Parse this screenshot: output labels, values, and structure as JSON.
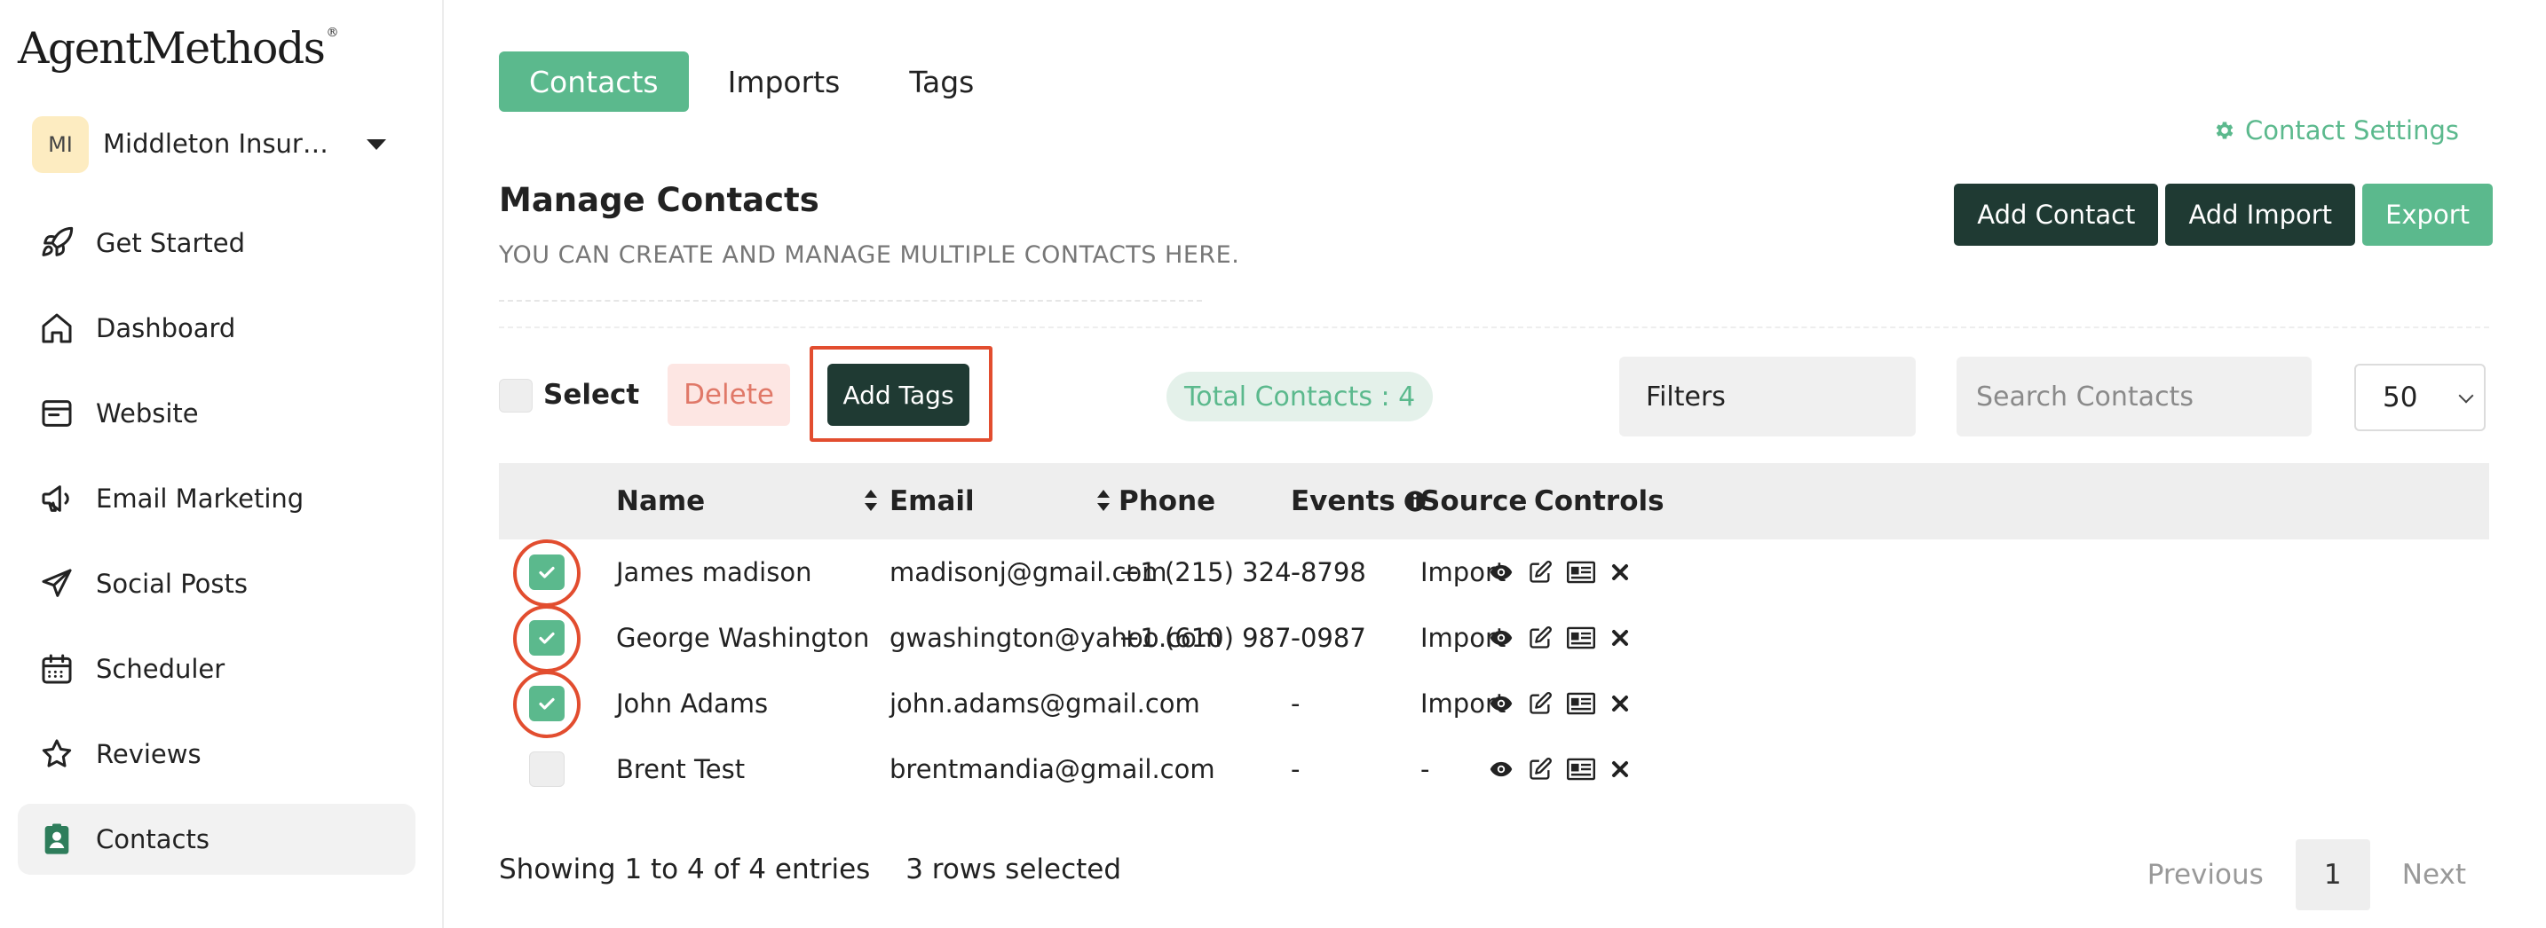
{
  "brand": {
    "logo_text": "AgentMethods",
    "logo_mark": "®"
  },
  "account": {
    "initials": "MI",
    "name": "Middleton Insura..."
  },
  "nav": [
    {
      "label": "Get Started",
      "icon": "rocket-icon"
    },
    {
      "label": "Dashboard",
      "icon": "home-icon"
    },
    {
      "label": "Website",
      "icon": "browser-icon"
    },
    {
      "label": "Email Marketing",
      "icon": "megaphone-icon"
    },
    {
      "label": "Social Posts",
      "icon": "send-icon"
    },
    {
      "label": "Scheduler",
      "icon": "calendar-icon"
    },
    {
      "label": "Reviews",
      "icon": "star-icon"
    },
    {
      "label": "Contacts",
      "icon": "contact-badge-icon",
      "active": true
    }
  ],
  "tabs": [
    {
      "label": "Contacts",
      "active": true
    },
    {
      "label": "Imports"
    },
    {
      "label": "Tags"
    }
  ],
  "settings_link": "Contact Settings",
  "header": {
    "title": "Manage Contacts",
    "subtitle": "YOU CAN CREATE AND MANAGE MULTIPLE CONTACTS HERE."
  },
  "actions": {
    "add_contact": "Add Contact",
    "add_import": "Add Import",
    "export": "Export"
  },
  "toolbar": {
    "select_label": "Select",
    "delete_label": "Delete",
    "add_tags_label": "Add Tags",
    "total_contacts": "Total Contacts : 4",
    "filters_label": "Filters",
    "search_placeholder": "Search Contacts",
    "page_size": "50"
  },
  "table": {
    "headers": {
      "name": "Name",
      "email": "Email",
      "phone": "Phone",
      "events": "Events",
      "source": "Source",
      "controls": "Controls"
    },
    "rows": [
      {
        "name": "James madison",
        "email": "madisonj@gmail.com",
        "phone": "+1 (215) 324-8798",
        "events": "-",
        "source": "Import",
        "checked": true
      },
      {
        "name": "George Washington",
        "email": "gwashington@yahoo.com",
        "phone": "+1 (610) 987-0987",
        "events": "-",
        "source": "Import",
        "checked": true
      },
      {
        "name": "John Adams",
        "email": "john.adams@gmail.com",
        "phone": "",
        "events": "-",
        "source": "Import",
        "checked": true
      },
      {
        "name": "Brent Test",
        "email": "brentmandia@gmail.com",
        "phone": "",
        "events": "-",
        "source": "-",
        "checked": false
      }
    ]
  },
  "footer": {
    "showing": "Showing 1 to 4 of 4 entries",
    "selected": "3 rows selected",
    "previous": "Previous",
    "current_page": "1",
    "next": "Next"
  },
  "colors": {
    "accent_green": "#5bb98d",
    "dark_green": "#1f3a33",
    "highlight_red": "#e24d2f",
    "delete_bg": "#fde6e3"
  }
}
